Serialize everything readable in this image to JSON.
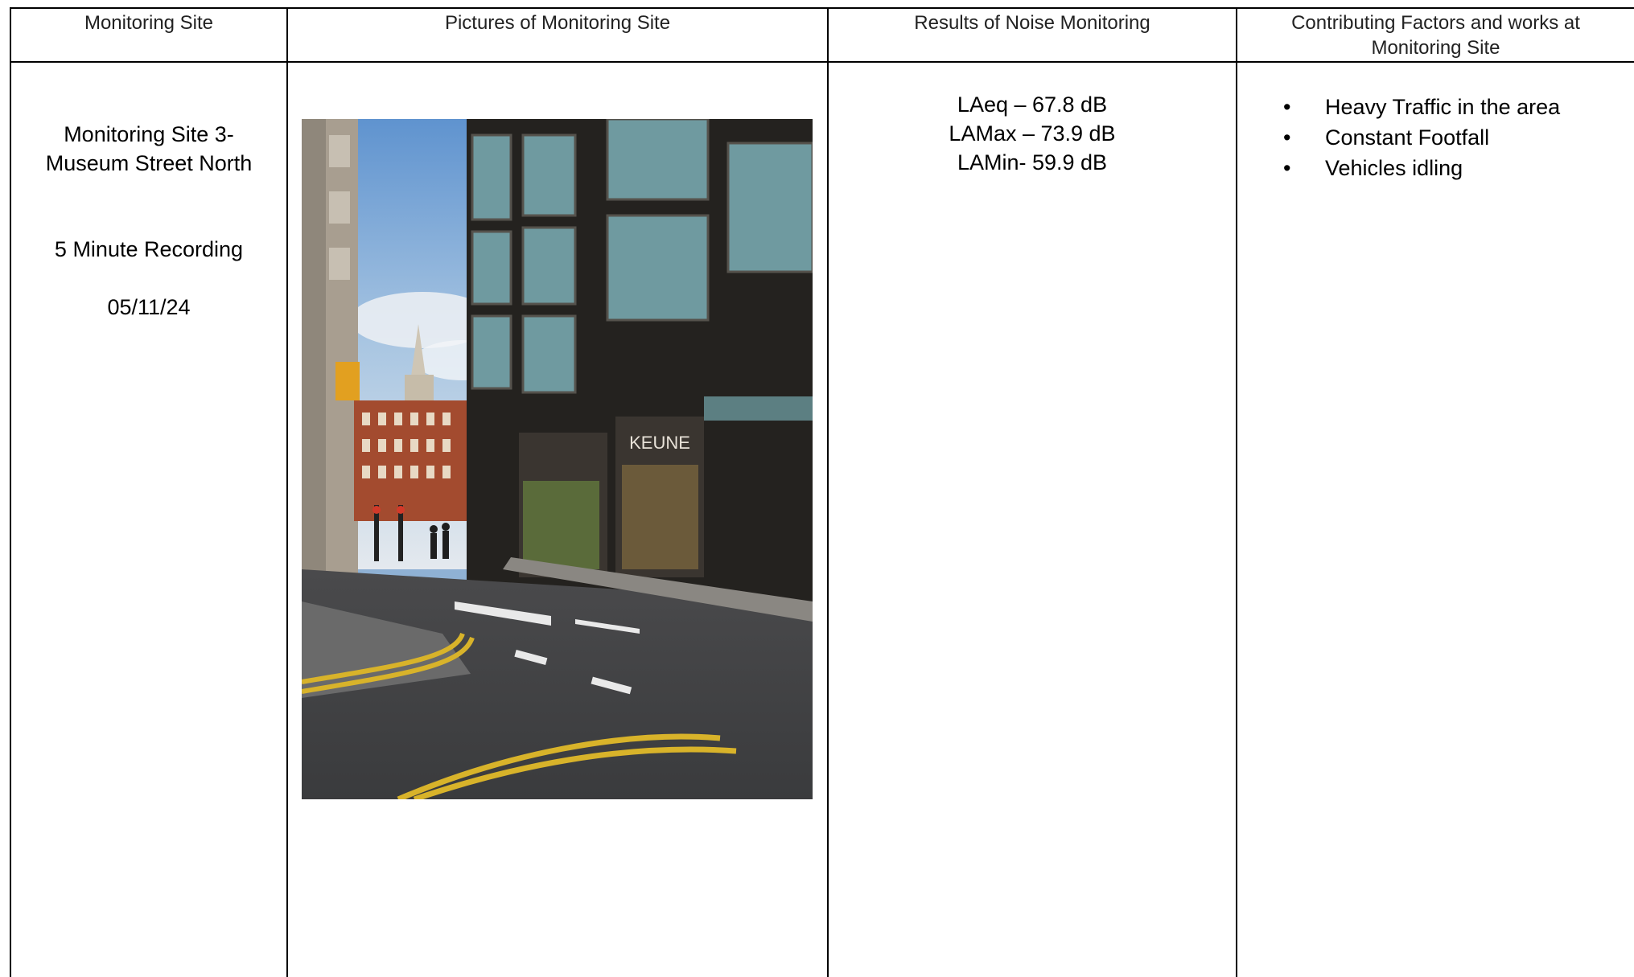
{
  "table": {
    "headers": [
      "Monitoring Site",
      "Pictures of Monitoring Site",
      "Results of Noise Monitoring",
      "Contributing Factors and works at Monitoring Site"
    ],
    "row": {
      "site": {
        "name_line1": "Monitoring Site 3-",
        "name_line2": "Museum Street North",
        "recording": "5 Minute Recording",
        "date": "05/11/24"
      },
      "photo": {
        "description_icon": "street-photo",
        "sign_text": "KEUNE"
      },
      "results": [
        "LAeq – 67.8 dB",
        "LAMax – 73.9 dB",
        "LAMin- 59.9 dB"
      ],
      "factors": [
        "Heavy Traffic in the area",
        "Constant Footfall",
        "Vehicles idling"
      ],
      "bullet_glyph": "•"
    }
  }
}
